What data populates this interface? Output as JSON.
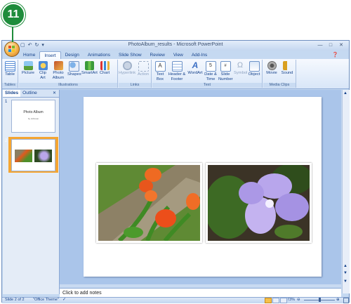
{
  "callout": {
    "number": "11"
  },
  "window": {
    "title": "PhotoAlbum_results - Microsoft PowerPoint"
  },
  "tabs": [
    "Home",
    "Insert",
    "Design",
    "Animations",
    "Slide Show",
    "Review",
    "View",
    "Add-Ins"
  ],
  "ribbon": {
    "groups": [
      "Tables",
      "Illustrations",
      "Links",
      "Text",
      "Media Clips"
    ],
    "buttons": {
      "table": "Table",
      "picture": "Picture",
      "clip_art": "Clip Art",
      "photo_album": "Photo Album",
      "shapes": "Shapes",
      "smartart": "SmartArt",
      "chart": "Chart",
      "hyperlink": "Hyperlink",
      "action": "Action",
      "text_box": "Text Box",
      "header_footer": "Header & Footer",
      "wordart": "WordArt",
      "date_time": "Date & Time",
      "slide_number": "Slide Number",
      "symbol": "Symbol",
      "object": "Object",
      "movie": "Movie",
      "sound": "Sound"
    }
  },
  "panel": {
    "tabs": [
      "Slides",
      "Outline"
    ],
    "slide1": {
      "number": "1",
      "title": "Photo Album",
      "subtitle": "by Johnson"
    },
    "slide2": {
      "number": "2"
    }
  },
  "notes": {
    "placeholder": "Click to add notes"
  },
  "status": {
    "slide": "Slide 2 of 2",
    "theme": "\"Office Theme\"",
    "zoom": "73%"
  },
  "colors": {
    "callout": "#1e8c3b",
    "ribbon_text": "#15428b",
    "selected_thumb": "#f5a531"
  }
}
